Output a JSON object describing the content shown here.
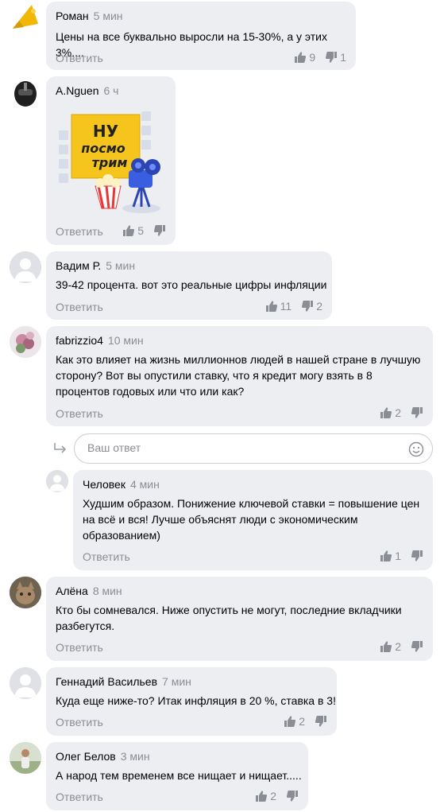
{
  "reply_label": "Ответить",
  "reply_input": {
    "placeholder": "Ваш ответ"
  },
  "colors": {
    "bubble": "#eceef2",
    "muted": "#8a8d94",
    "sticker_yellow": "#f6c51d",
    "sticker_blue": "#3a5ee0"
  },
  "sticker": {
    "line1": "НУ",
    "line2": "посмо",
    "line3": "трим"
  },
  "comments": [
    {
      "author": "Роман",
      "time": "5 мин",
      "text": [
        "Цены на все буквально выросли на 15-30%, а у этих 3%...."
      ],
      "likes": "9",
      "dislikes": "1",
      "avatar": "megaphone-icon"
    },
    {
      "author": "A.Nguen",
      "time": "6 ч",
      "text": [],
      "likes": "5",
      "dislikes": "",
      "avatar": "helmet-icon"
    },
    {
      "author": "Вадим Р.",
      "time": "5 мин",
      "text": [
        "39-42 процента. вот это реальные цифры инфляции"
      ],
      "likes": "11",
      "dislikes": "2",
      "avatar": "default-user-icon"
    },
    {
      "author": "fabrizzio4",
      "time": "10 мин",
      "text": [
        "Как это влияет на жизнь миллионнов людей в нашей стране в лучшую",
        "сторону? Вот вы опустили ставку, что я кредит могу взять в 8",
        "процентов годовых или что или как?"
      ],
      "likes": "2",
      "dislikes": "",
      "avatar": "flowers-photo"
    },
    {
      "author": "Человек",
      "time": "4 мин",
      "text": [
        "Худшим образом. Понижение ключевой ставки = повышение цен",
        "на всё и вся! Лучше объяснят люди с экономическим",
        "образованием)"
      ],
      "likes": "1",
      "dislikes": "",
      "avatar": "default-user-icon"
    },
    {
      "author": "Алёна",
      "time": "8 мин",
      "text": [
        "Кто бы сомневался. Ниже опустить не могут, последние вкладчики",
        "разбегутся."
      ],
      "likes": "2",
      "dislikes": "",
      "avatar": "cat-photo"
    },
    {
      "author": "Геннадий Васильев",
      "time": "7 мин",
      "text": [
        "Куда еще ниже-то? Итак инфляция в 20 %, ставка в 3!"
      ],
      "likes": "2",
      "dislikes": "",
      "avatar": "default-user-icon"
    },
    {
      "author": "Олег Белов",
      "time": "3 мин",
      "text": [
        "А народ тем временем все нищает и нищает....."
      ],
      "likes": "2",
      "dislikes": "",
      "avatar": "outdoor-photo"
    }
  ]
}
